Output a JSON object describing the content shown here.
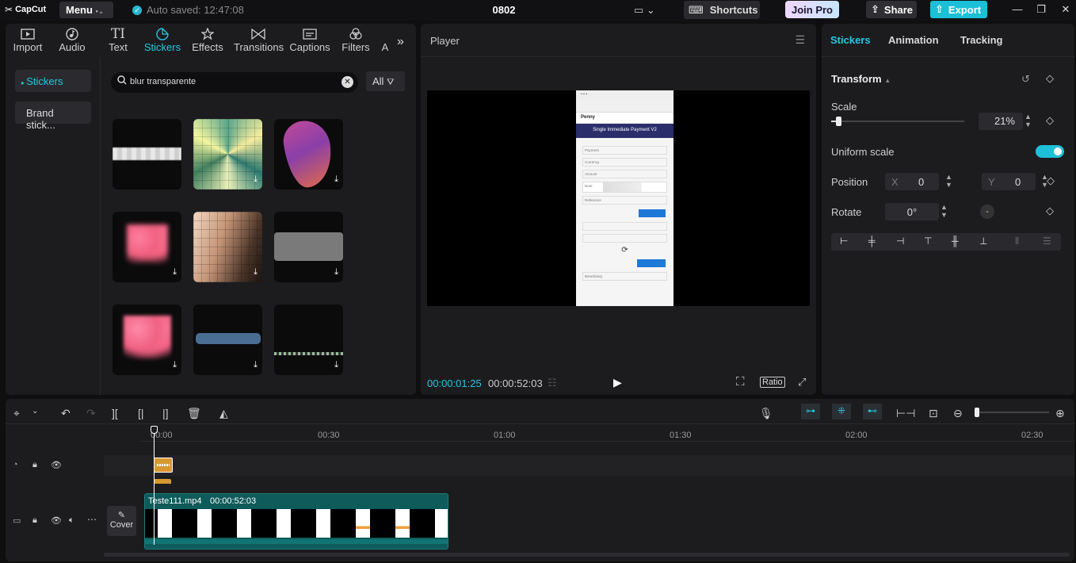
{
  "titlebar": {
    "logo": "CapCut",
    "menu": "Menu",
    "autosave": "Auto saved: 12:47:08",
    "project_title": "0802",
    "shortcuts": "Shortcuts",
    "join_pro": "Join Pro",
    "share": "Share",
    "export": "Export"
  },
  "toolbar": {
    "tabs": [
      {
        "label": "Import",
        "icon": "import-icon"
      },
      {
        "label": "Audio",
        "icon": "audio-icon"
      },
      {
        "label": "Text",
        "icon": "text-icon"
      },
      {
        "label": "Stickers",
        "icon": "stickers-icon"
      },
      {
        "label": "Effects",
        "icon": "effects-icon"
      },
      {
        "label": "Transitions",
        "icon": "transitions-icon"
      },
      {
        "label": "Captions",
        "icon": "captions-icon"
      },
      {
        "label": "Filters",
        "icon": "filters-icon"
      },
      {
        "label": "A",
        "icon": "adjustment-icon"
      }
    ],
    "active_tab": "Stickers"
  },
  "stickers_panel": {
    "sidebar": [
      "Stickers",
      "Brand stick..."
    ],
    "search_value": "blur transparente",
    "filter_label": "All",
    "tiles": [
      {
        "name": "white-blur-bar"
      },
      {
        "name": "colorful-pixel-mosaic"
      },
      {
        "name": "purple-gradient-blob"
      },
      {
        "name": "pink-blurry-heart"
      },
      {
        "name": "skin-pixel-mosaic"
      },
      {
        "name": "gray-blur-rectangle"
      },
      {
        "name": "pink-heart"
      },
      {
        "name": "blue-blur-bar"
      },
      {
        "name": "dark-glitch-strip"
      }
    ]
  },
  "player": {
    "title": "Player",
    "current_time": "00:00:01:25",
    "total_time": "00:00:52:03",
    "ratio": "Ratio",
    "phone_preview": {
      "app_name": "Penny",
      "heading": "Single Immediate Payment V2",
      "fields": [
        "Payment",
        "Currency",
        "Amount",
        "Note",
        "Reference",
        "Beneficiary"
      ]
    }
  },
  "inspector": {
    "tabs": [
      "Stickers",
      "Animation",
      "Tracking"
    ],
    "section": "Transform",
    "scale_label": "Scale",
    "scale_value": "21%",
    "uniform_scale_label": "Uniform scale",
    "uniform_scale_on": true,
    "position_label": "Position",
    "pos_x_label": "X",
    "pos_x": "0",
    "pos_y_label": "Y",
    "pos_y": "0",
    "rotate_label": "Rotate",
    "rotate_value": "0°",
    "accent": "#22c8e0"
  },
  "timeline": {
    "ruler": [
      "00:00",
      "00:30",
      "01:00",
      "01:30",
      "02:00",
      "02:30"
    ],
    "video_clip": {
      "name": "Teste111.mp4",
      "duration": "00:00:52:03"
    },
    "cover_label": "Cover"
  }
}
